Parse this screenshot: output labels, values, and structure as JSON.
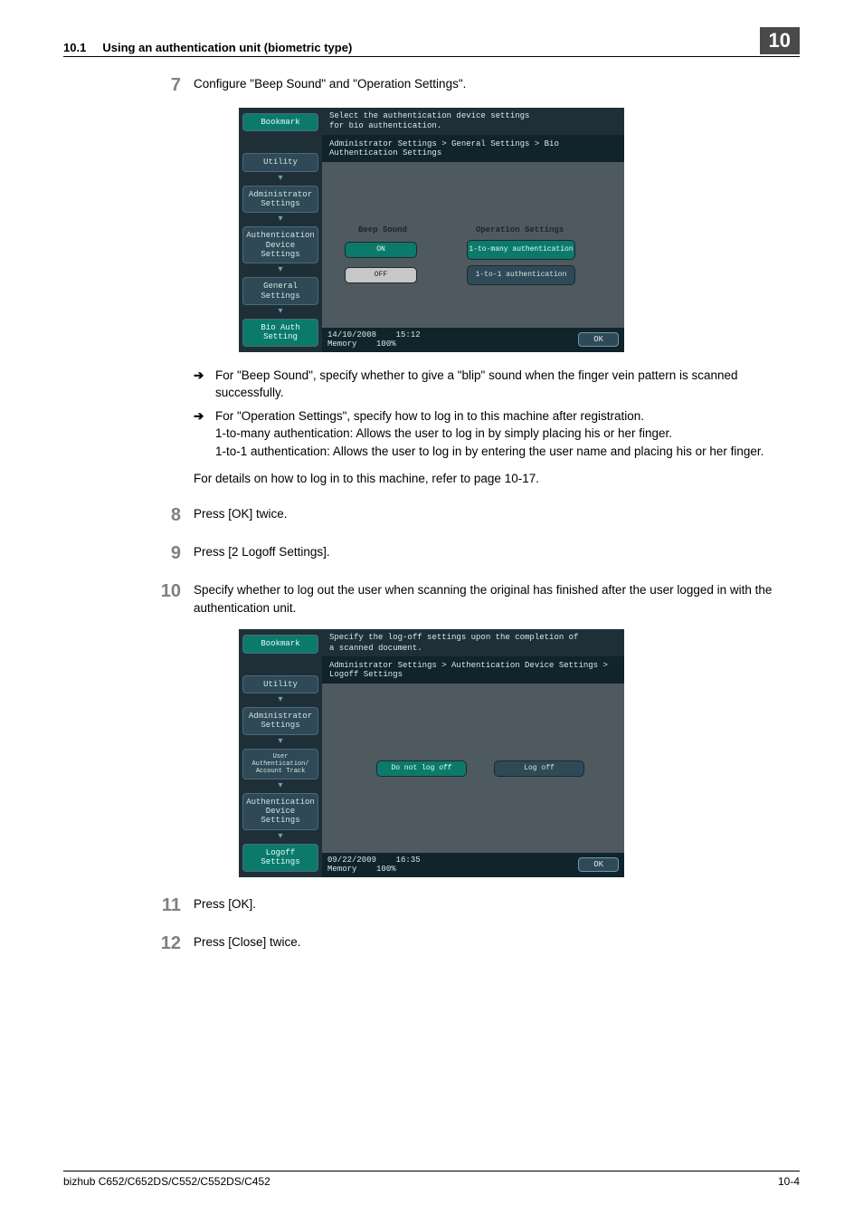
{
  "header": {
    "section_num": "10.1",
    "section_title": "Using an authentication unit (biometric type)",
    "chapter_num": "10"
  },
  "steps": {
    "s7": {
      "num": "7",
      "text": "Configure \"Beep Sound\" and \"Operation Settings\".",
      "bullets": [
        "For \"Beep Sound\", specify whether to give a \"blip\" sound when the finger vein pattern is scanned successfully.",
        "For \"Operation Settings\", specify how to log in to this machine after registration.\n1-to-many authentication: Allows the user to log in by simply placing his or her finger.\n1-to-1 authentication: Allows the user to log in by entering the user name and placing his or her finger."
      ],
      "followup": "For details on how to log in to this machine, refer to page 10-17."
    },
    "s8": {
      "num": "8",
      "text": "Press [OK] twice."
    },
    "s9": {
      "num": "9",
      "text": "Press [2 Logoff Settings]."
    },
    "s10": {
      "num": "10",
      "text": "Specify whether to log out the user when scanning the original has finished after the user logged in with the authentication unit."
    },
    "s11": {
      "num": "11",
      "text": "Press [OK]."
    },
    "s12": {
      "num": "12",
      "text": "Press [Close] twice."
    }
  },
  "panel1": {
    "header_line1": "Select the authentication device settings",
    "header_line2": "for bio authentication.",
    "crumb": "Administrator Settings > General Settings > Bio Authentication Settings",
    "side": {
      "bookmark": "Bookmark",
      "utility": "Utility",
      "admin": "Administrator Settings",
      "authdev": "Authentication Device Settings",
      "general": "General Settings",
      "bioauth": "Bio Auth Setting"
    },
    "col_beep": "Beep Sound",
    "col_op": "Operation Settings",
    "btn_on": "ON",
    "btn_off": "OFF",
    "btn_1tomany": "1-to-many authentication",
    "btn_1to1": "1-to-1 authentication",
    "footer_date": "14/10/2008",
    "footer_time": "15:12",
    "footer_mem_label": "Memory",
    "footer_mem_val": "100%",
    "ok": "OK"
  },
  "panel2": {
    "header_line1": "Specify the log-off settings upon the completion of",
    "header_line2": "a scanned document.",
    "crumb": "Administrator Settings > Authentication Device Settings > Logoff Settings",
    "side": {
      "bookmark": "Bookmark",
      "utility": "Utility",
      "admin": "Administrator Settings",
      "userauth": "User Authentication/ Account Track",
      "authdev": "Authentication Device Settings",
      "logoff": "Logoff Settings"
    },
    "btn_dontlogoff": "Do not log off",
    "btn_logoff": "Log off",
    "footer_date": "09/22/2009",
    "footer_time": "16:35",
    "footer_mem_label": "Memory",
    "footer_mem_val": "100%",
    "ok": "OK"
  },
  "footer": {
    "model": "bizhub C652/C652DS/C552/C552DS/C452",
    "page": "10-4"
  }
}
